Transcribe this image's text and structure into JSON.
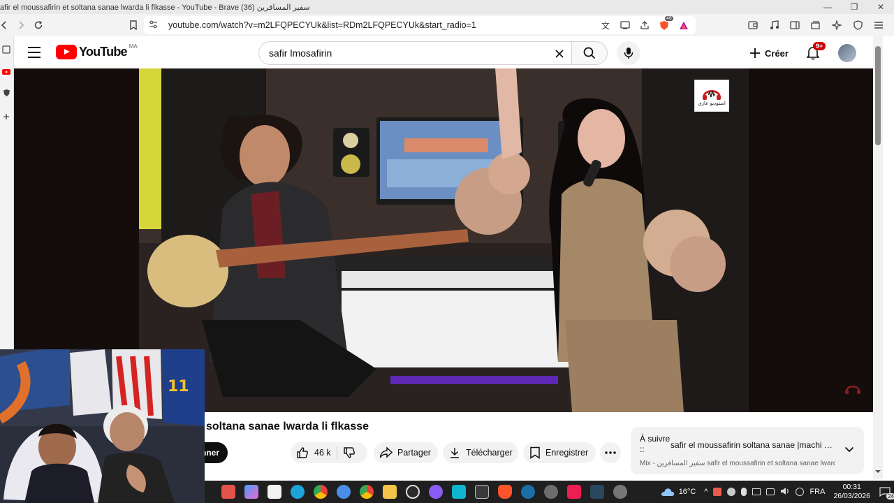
{
  "window": {
    "title": "afir el moussafirin et soltana sanae lwarda li flkasse - YouTube - Brave سفير المسافرين (36)",
    "controls": [
      "—",
      "❐",
      "✕"
    ]
  },
  "browser": {
    "url": "youtube.com/watch?v=m2LFQPECYUk&list=RDm2LFQPECYUk&start_radio=1",
    "shield_badge": "46"
  },
  "youtube": {
    "logo_text": "YouTube",
    "country_code": "MA",
    "search_value": "safir lmosafirin",
    "create_label": "Créer",
    "notification_count": "9+",
    "brand_color": "#ff0000"
  },
  "video": {
    "title": "soltana sanae lwarda li flkasse",
    "channel_logo_text": "استوديو عازي",
    "subscribe_label": "nner",
    "likes": "46 k",
    "share_label": "Partager",
    "download_label": "Télécharger",
    "save_label": "Enregistrer"
  },
  "up_next": {
    "label": "À suivre ::",
    "title": "safir el moussafirin soltana sanae |machi h...",
    "mix_line": "Mix - سفير المسافرين safir el moussafirin et soltana sanae lward..."
  },
  "taskbar": {
    "weather": "16°C",
    "language": "FRA",
    "time": "00:31",
    "date": "26/03/2026",
    "notification_count": "24"
  }
}
